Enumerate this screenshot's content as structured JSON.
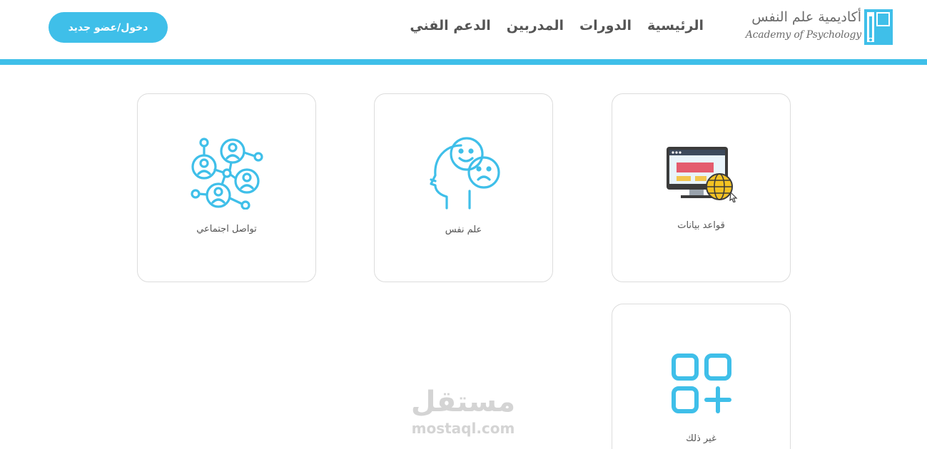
{
  "theme": {
    "accent": "#3fbfe9",
    "text": "#555555",
    "watermark": "#d4d4d4"
  },
  "header": {
    "login_label": "دخول/عضو جديد",
    "nav": [
      "الرئيسية",
      "الدورات",
      "المدربين",
      "الدعم الفني"
    ],
    "logo": {
      "arabic": "أكاديمية علم النفس",
      "english": "Academy of Psychology"
    }
  },
  "categories": [
    {
      "label": "قواعد بيانات",
      "icon": "database-monitor-globe-icon"
    },
    {
      "label": "علم نفس",
      "icon": "head-emotions-icon"
    },
    {
      "label": "تواصل اجتماعي",
      "icon": "social-network-icon"
    },
    {
      "label": "غير ذلك",
      "icon": "grid-plus-icon"
    }
  ],
  "watermark": {
    "arabic": "مستقل",
    "english": "mostaql.com"
  }
}
